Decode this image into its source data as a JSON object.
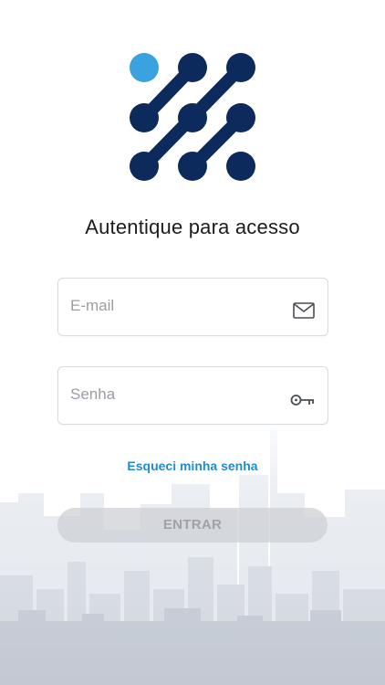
{
  "app": {
    "brand_logo": "dot-network-logo"
  },
  "auth": {
    "title": "Autentique para acesso",
    "email": {
      "value": "",
      "placeholder": "E-mail",
      "icon": "mail-icon"
    },
    "password": {
      "value": "",
      "placeholder": "Senha",
      "icon": "key-icon"
    },
    "forgot_link": "Esqueci minha senha",
    "submit_label": "ENTRAR"
  },
  "colors": {
    "brand_dark": "#0d2a5c",
    "brand_light": "#3aa2df",
    "link": "#1f8ccd",
    "button_disabled_bg": "#cdd0d5",
    "button_disabled_text": "#9ea2a9"
  }
}
